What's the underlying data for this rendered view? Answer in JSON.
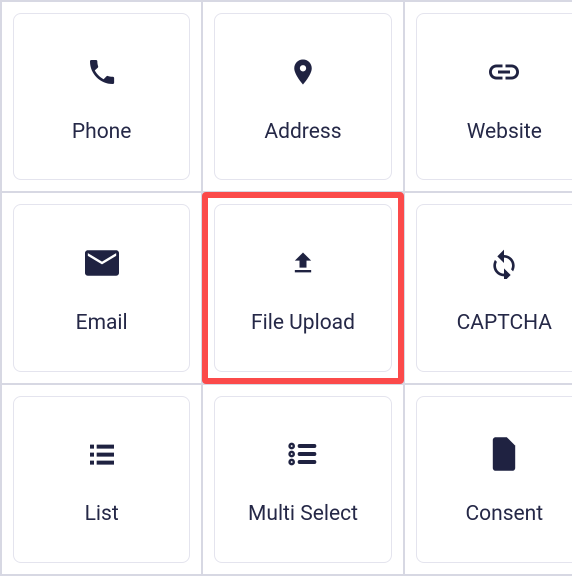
{
  "grid": {
    "items": [
      {
        "id": "phone",
        "label": "Phone",
        "icon": "phone-icon"
      },
      {
        "id": "address",
        "label": "Address",
        "icon": "map-pin-icon"
      },
      {
        "id": "website",
        "label": "Website",
        "icon": "link-icon"
      },
      {
        "id": "email",
        "label": "Email",
        "icon": "mail-icon"
      },
      {
        "id": "file-upload",
        "label": "File Upload",
        "icon": "upload-icon",
        "highlighted": true
      },
      {
        "id": "captcha",
        "label": "CAPTCHA",
        "icon": "refresh-icon"
      },
      {
        "id": "list",
        "label": "List",
        "icon": "list-icon"
      },
      {
        "id": "multi-select",
        "label": "Multi Select",
        "icon": "checklist-icon"
      },
      {
        "id": "consent",
        "label": "Consent",
        "icon": "document-icon"
      }
    ]
  },
  "colors": {
    "icon": "#1f2241",
    "text": "#252847",
    "border": "#d7d8e3",
    "cardBorder": "#e4e4ee",
    "highlight": "#fb4a4a"
  }
}
